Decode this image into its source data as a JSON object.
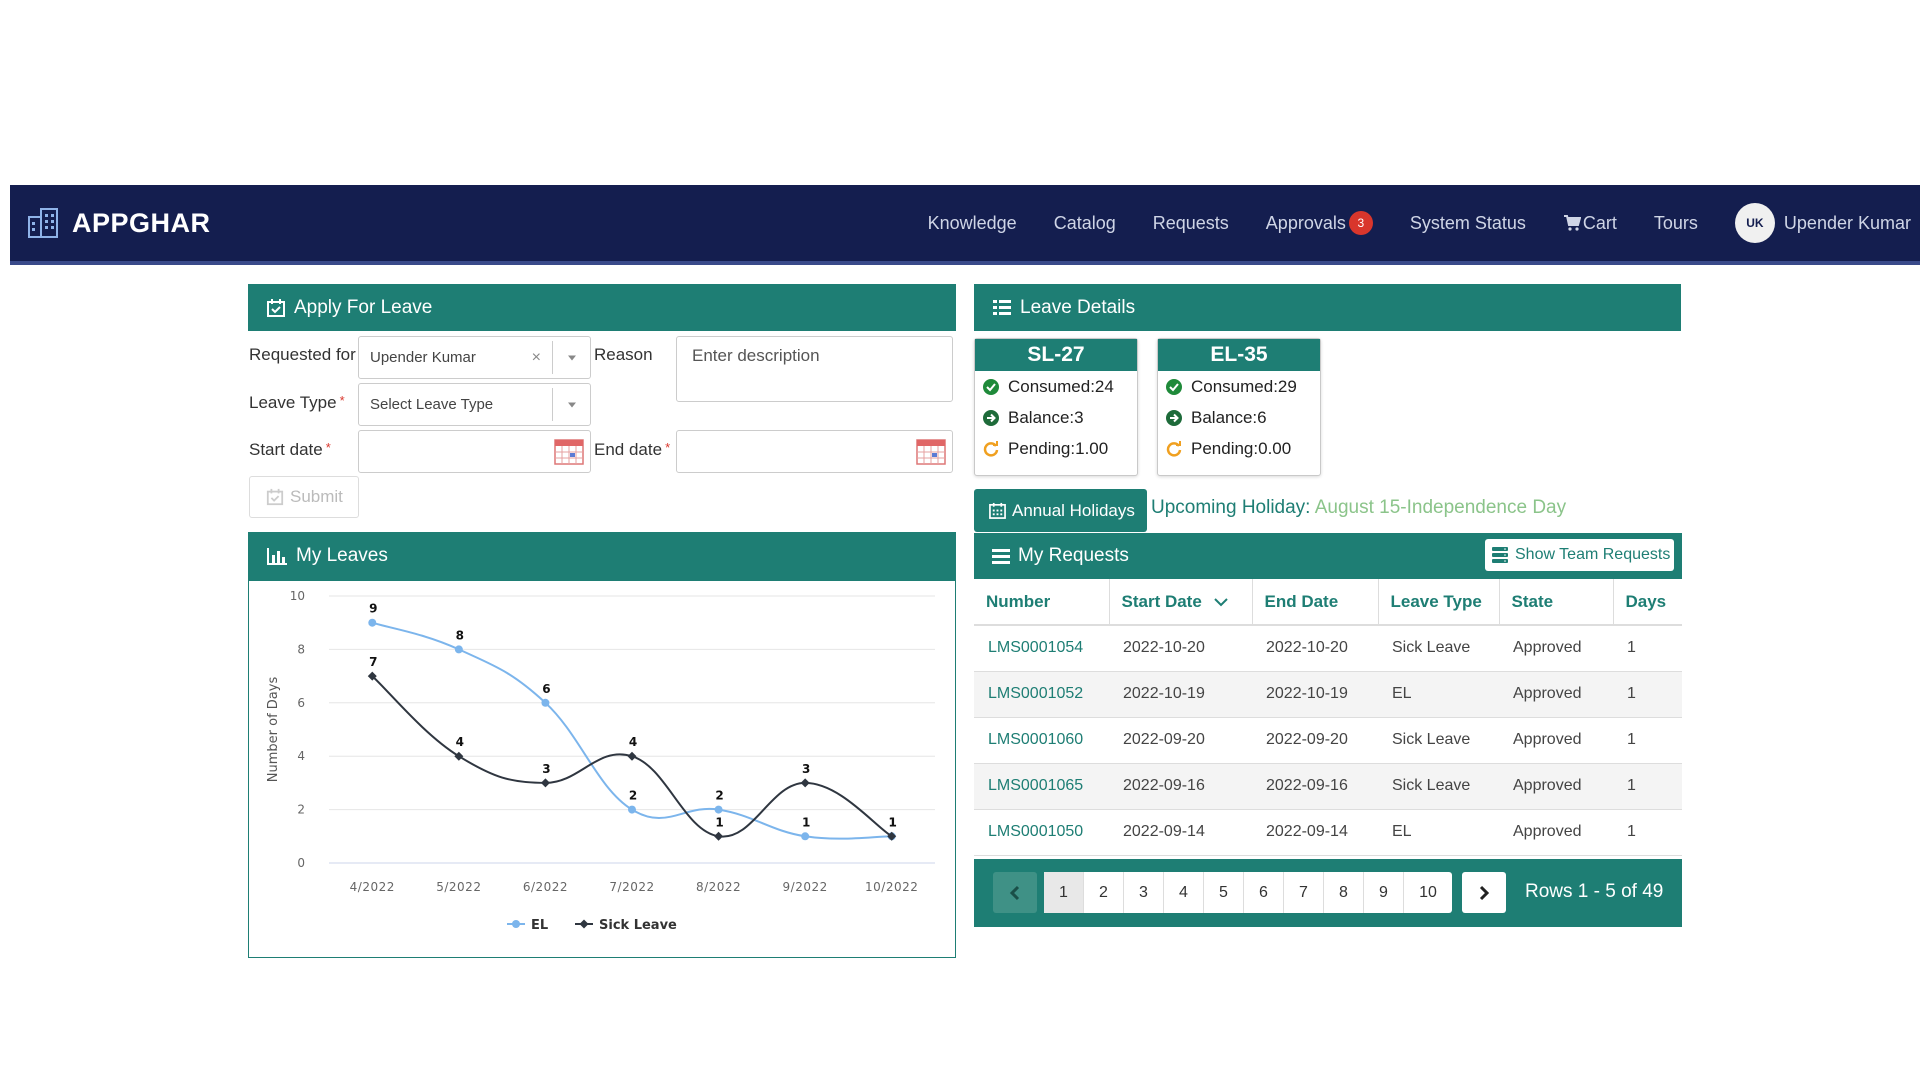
{
  "navbar": {
    "brand": "APPGHAR",
    "links": [
      {
        "label": "Knowledge"
      },
      {
        "label": "Catalog"
      },
      {
        "label": "Requests"
      },
      {
        "label": "Approvals",
        "badge": "3"
      },
      {
        "label": "System Status"
      },
      {
        "label": "Cart",
        "icon": "cart-icon"
      },
      {
        "label": "Tours"
      }
    ],
    "user_initials": "UK",
    "user_name": "Upender Kumar"
  },
  "apply": {
    "title": "Apply For Leave",
    "requested_for_label": "Requested for",
    "requested_for_value": "Upender Kumar",
    "reason_label": "Reason",
    "reason_placeholder": "Enter description",
    "leave_type_label": "Leave Type",
    "leave_type_placeholder": "Select Leave Type",
    "start_label": "Start date",
    "end_label": "End date",
    "required_mark": "*",
    "submit_label": "Submit"
  },
  "leave_details": {
    "title": "Leave Details",
    "cards": [
      {
        "title": "SL-27",
        "consumed": "Consumed:24",
        "balance": "Balance:3",
        "pending": "Pending:1.00"
      },
      {
        "title": "EL-35",
        "consumed": "Consumed:29",
        "balance": "Balance:6",
        "pending": "Pending:0.00"
      }
    ],
    "holidays_button": "Annual Holidays",
    "upcoming_label": "Upcoming Holiday:",
    "upcoming_value": "August 15-Independence Day"
  },
  "my_leaves": {
    "title": "My Leaves"
  },
  "chart_data": {
    "type": "line",
    "title": "",
    "xlabel": "",
    "ylabel": "Number of Days",
    "categories": [
      "4/2022",
      "5/2022",
      "6/2022",
      "7/2022",
      "8/2022",
      "9/2022",
      "10/2022"
    ],
    "ylim": [
      0,
      10
    ],
    "yticks": [
      0,
      2,
      4,
      6,
      8,
      10
    ],
    "series": [
      {
        "name": "EL",
        "values": [
          9,
          8,
          6,
          2,
          2,
          1,
          1
        ],
        "color": "#7cb5ec"
      },
      {
        "name": "Sick Leave",
        "values": [
          7,
          4,
          3,
          4,
          1,
          3,
          1
        ],
        "color": "#2f3640"
      }
    ],
    "legend": "bottom-center",
    "grid": true
  },
  "requests": {
    "title": "My Requests",
    "team_button": "Show Team Requests",
    "columns": [
      "Number",
      "Start Date",
      "End Date",
      "Leave Type",
      "State",
      "Days"
    ],
    "rows": [
      [
        "LMS0001054",
        "2022-10-20",
        "2022-10-20",
        "Sick Leave",
        "Approved",
        "1"
      ],
      [
        "LMS0001052",
        "2022-10-19",
        "2022-10-19",
        "EL",
        "Approved",
        "1"
      ],
      [
        "LMS0001060",
        "2022-09-20",
        "2022-09-20",
        "Sick Leave",
        "Approved",
        "1"
      ],
      [
        "LMS0001065",
        "2022-09-16",
        "2022-09-16",
        "Sick Leave",
        "Approved",
        "1"
      ],
      [
        "LMS0001050",
        "2022-09-14",
        "2022-09-14",
        "EL",
        "Approved",
        "1"
      ]
    ],
    "pages": [
      "1",
      "2",
      "3",
      "4",
      "5",
      "6",
      "7",
      "8",
      "9",
      "10"
    ],
    "current_page": "1",
    "rows_info": "Rows 1 - 5 of 49"
  },
  "colors": {
    "navbar": "#141e4f",
    "accent": "#1e7e74",
    "badge": "#d9362c",
    "holiday_value": "#8bc48a"
  }
}
